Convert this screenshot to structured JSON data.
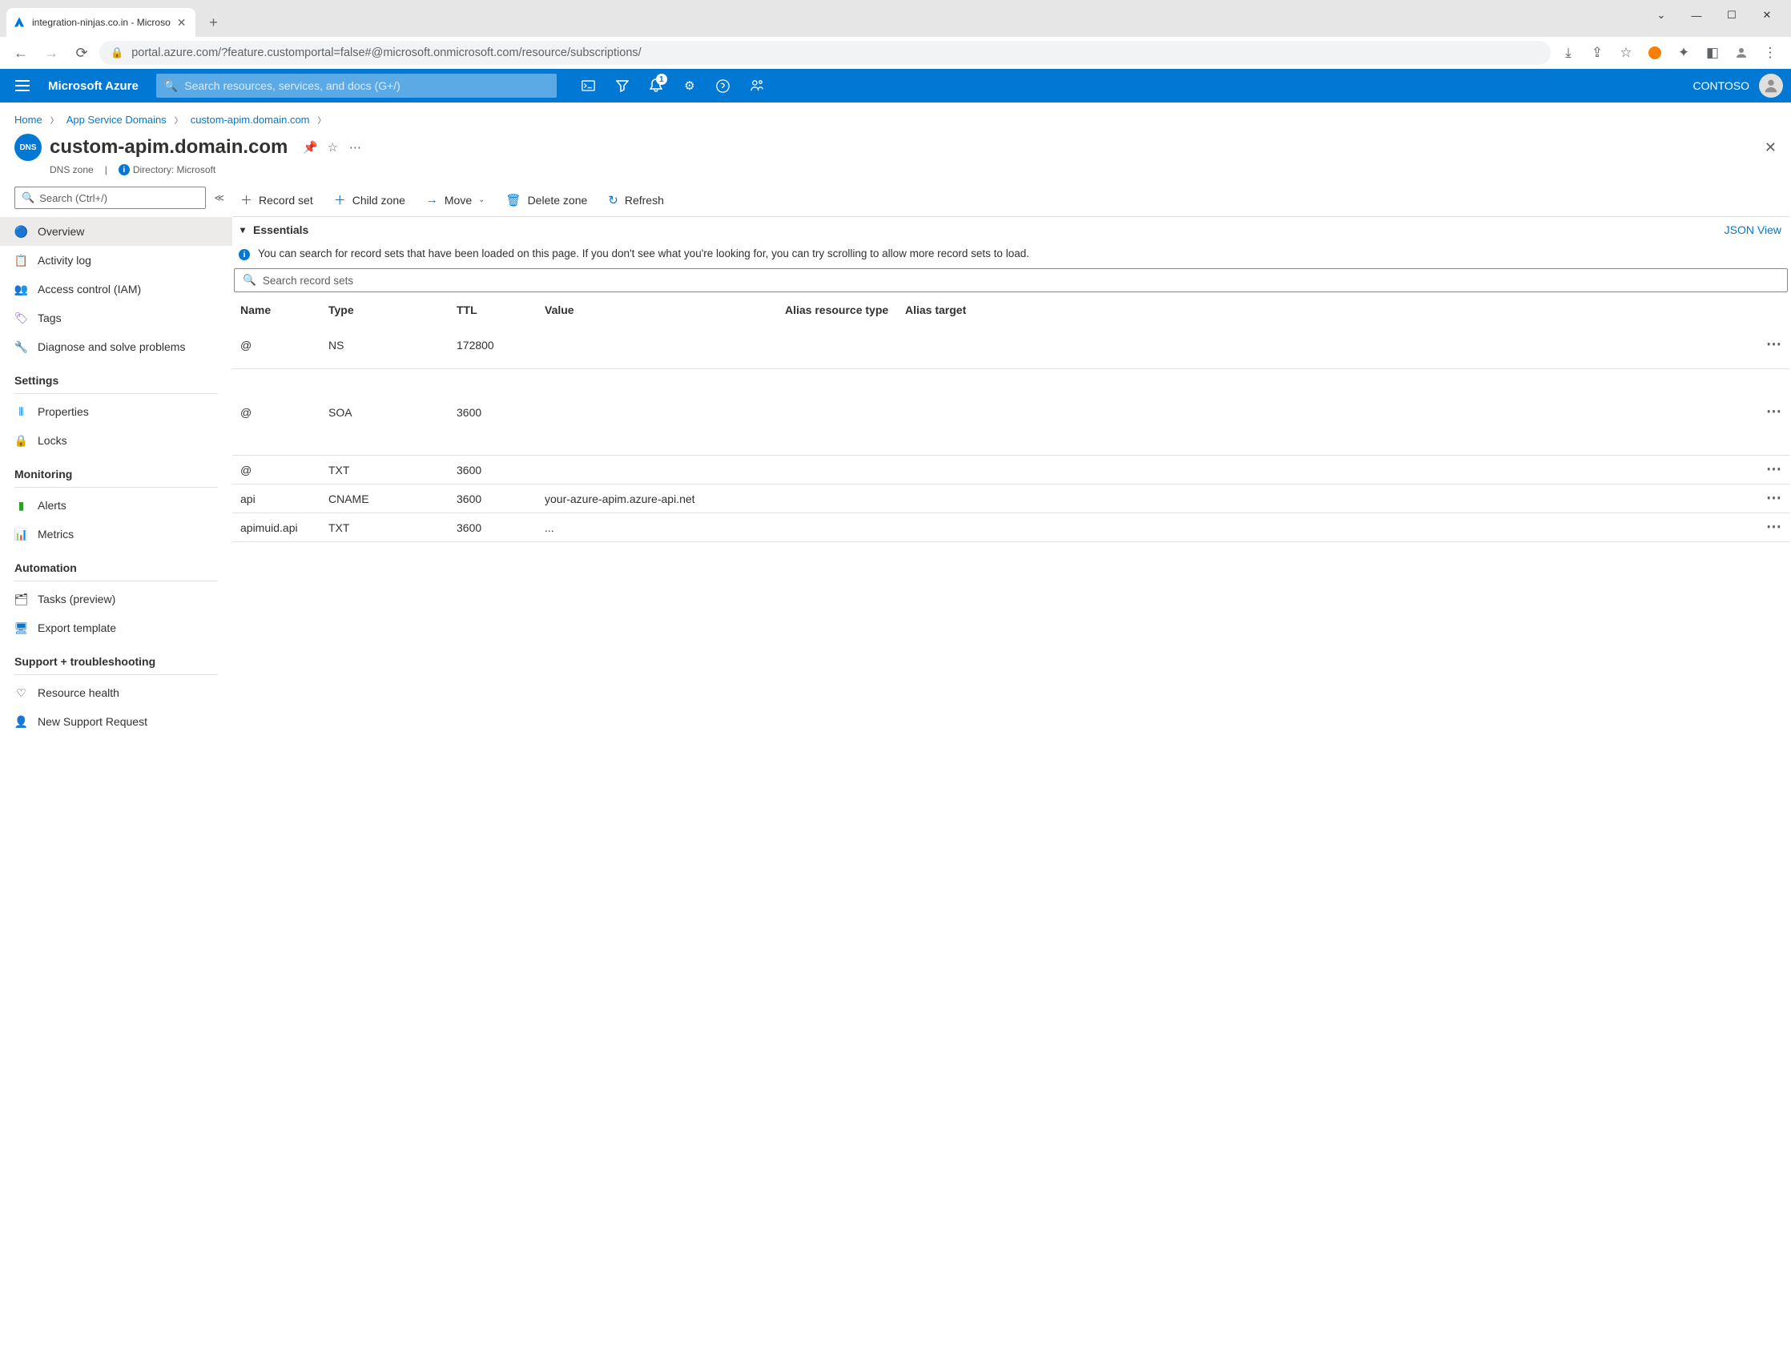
{
  "browser": {
    "tab_title": "integration-ninjas.co.in - Microso",
    "url": "portal.azure.com/?feature.customportal=false#@microsoft.onmicrosoft.com/resource/subscriptions/"
  },
  "azure": {
    "brand": "Microsoft Azure",
    "search_placeholder": "Search resources, services, and docs (G+/)",
    "notification_badge": "1",
    "tenant": "CONTOSO"
  },
  "breadcrumb": {
    "home": "Home",
    "svc": "App Service Domains",
    "res": "custom-apim.domain.com"
  },
  "header": {
    "icon_label": "DNS",
    "title": "custom-apim.domain.com",
    "subtitle": "DNS zone",
    "directory_label": "Directory: Microsoft"
  },
  "sidebar": {
    "search_placeholder": "Search (Ctrl+/)",
    "items": {
      "overview": "Overview",
      "activity": "Activity log",
      "iam": "Access control (IAM)",
      "tags": "Tags",
      "diagnose": "Diagnose and solve problems"
    },
    "settings_label": "Settings",
    "settings": {
      "properties": "Properties",
      "locks": "Locks"
    },
    "monitoring_label": "Monitoring",
    "monitoring": {
      "alerts": "Alerts",
      "metrics": "Metrics"
    },
    "automation_label": "Automation",
    "automation": {
      "tasks": "Tasks (preview)",
      "export": "Export template"
    },
    "support_label": "Support + troubleshooting",
    "support": {
      "health": "Resource health",
      "request": "New Support Request"
    }
  },
  "toolbar": {
    "record_set": "Record set",
    "child_zone": "Child zone",
    "move": "Move",
    "delete_zone": "Delete zone",
    "refresh": "Refresh"
  },
  "essentials": {
    "label": "Essentials",
    "json_view": "JSON View"
  },
  "info_text": "You can search for record sets that have been loaded on this page. If you don't see what you're looking for, you can try scrolling to allow more record sets to load.",
  "record_search_placeholder": "Search record sets",
  "table": {
    "headers": {
      "name": "Name",
      "type": "Type",
      "ttl": "TTL",
      "value": "Value",
      "alias_type": "Alias resource type",
      "alias_target": "Alias target"
    },
    "rows": [
      {
        "name": "@",
        "type": "NS",
        "ttl": "172800",
        "value": "",
        "alias_type": "",
        "alias_target": ""
      },
      {
        "name": "@",
        "type": "SOA",
        "ttl": "3600",
        "value": "",
        "alias_type": "",
        "alias_target": ""
      },
      {
        "name": "@",
        "type": "TXT",
        "ttl": "3600",
        "value": "",
        "alias_type": "",
        "alias_target": ""
      },
      {
        "name": "api",
        "type": "CNAME",
        "ttl": "3600",
        "value": "your-azure-apim.azure-api.net",
        "alias_type": "",
        "alias_target": ""
      },
      {
        "name": "apimuid.api",
        "type": "TXT",
        "ttl": "3600",
        "value": "...",
        "alias_type": "",
        "alias_target": ""
      }
    ]
  }
}
